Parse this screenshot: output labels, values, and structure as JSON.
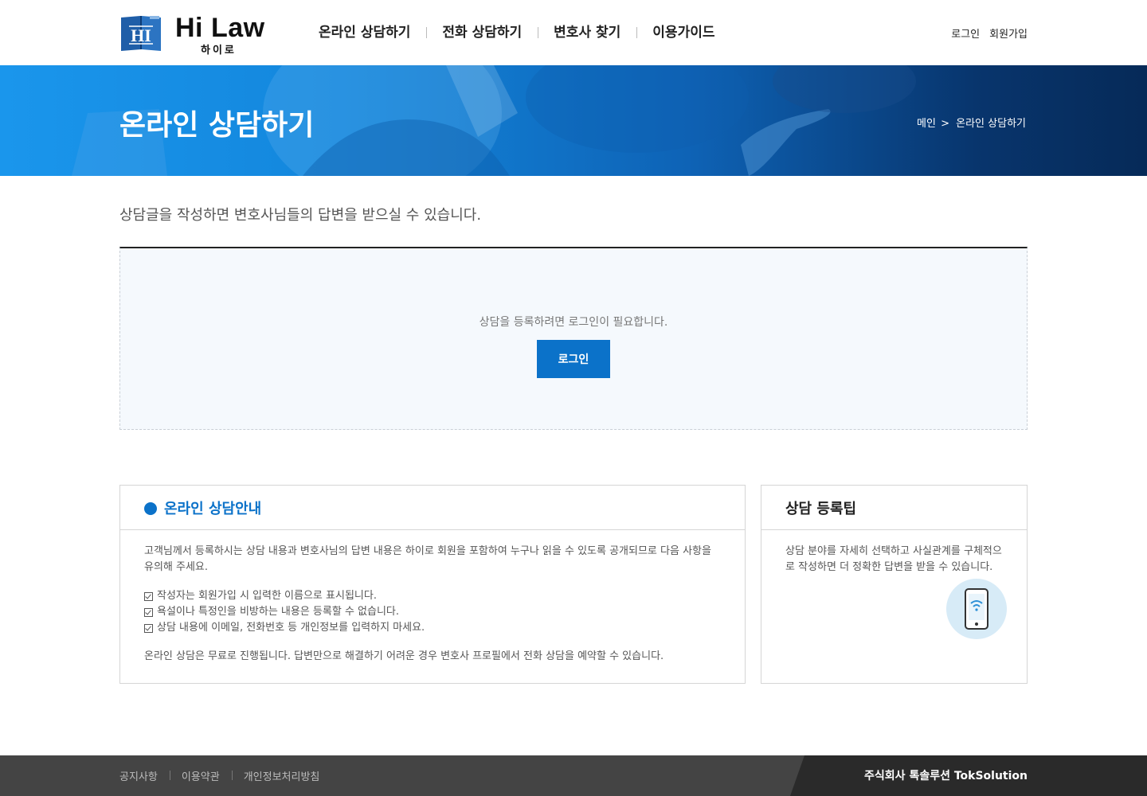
{
  "header": {
    "logo": {
      "title": "Hi Law",
      "subtitle": "하이로",
      "mark": "HI"
    },
    "nav": [
      "온라인 상담하기",
      "전화 상담하기",
      "변호사 찾기",
      "이용가이드"
    ],
    "util": {
      "login": "로그인",
      "signup": "회원가입"
    }
  },
  "banner": {
    "title": "온라인 상담하기",
    "breadcrumb": {
      "home": "메인",
      "separator": ">",
      "current": "온라인 상담하기"
    }
  },
  "intro": "상담글을 작성하면 변호사님들의 답변을 받으실 수 있습니다.",
  "login_box": {
    "message": "상담을 등록하려면 로그인이 필요합니다.",
    "button": "로그인"
  },
  "guide": {
    "title": "온라인 상담안내",
    "intro": "고객님께서 등록하시는 상담 내용과 변호사님의 답변 내용은 하이로 회원을 포함하여 누구나 읽을 수 있도록 공개되므로 다음 사항을 유의해 주세요.",
    "rules": [
      "작성자는 회원가입 시 입력한 이름으로 표시됩니다.",
      "욕설이나 특정인을 비방하는 내용은 등록할 수 없습니다.",
      "상담 내용에 이메일, 전화번호 등 개인정보를 입력하지 마세요."
    ],
    "note": "온라인 상담은 무료로 진행됩니다. 답변만으로 해결하기 어려운 경우 변호사 프로필에서 전화 상담을 예약할 수 있습니다."
  },
  "tip": {
    "title": "상담 등록팁",
    "text": "상담 분야를 자세히 선택하고 사실관계를 구체적으로 작성하면 더 정확한 답변을 받을 수 있습니다.",
    "icon": "smartphone-wifi-icon"
  },
  "footer": {
    "links": [
      "공지사항",
      "이용약관",
      "개인정보처리방침"
    ],
    "company": "주식회사 톡솔루션 TokSolution"
  },
  "colors": {
    "primary": "#0b72c9",
    "banner_start": "#1a96ec",
    "banner_end": "#062a58",
    "footer": "#444444",
    "footer_dark": "#2a2a2a"
  }
}
